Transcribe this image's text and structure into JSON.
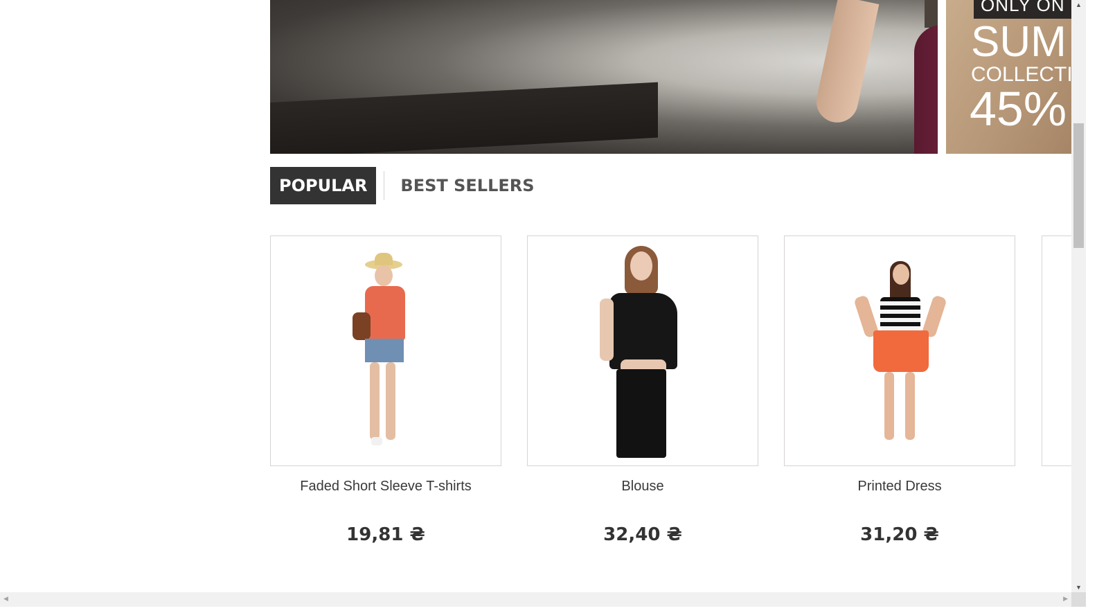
{
  "slider": {
    "prev_icon": "‹",
    "next_icon": "›"
  },
  "promo": {
    "tag": "ONLY ON",
    "headline": "SUM",
    "subline": "COLLECTIO",
    "discount": "45%"
  },
  "tabs": {
    "popular": "POPULAR",
    "best_sellers": "BEST SELLERS"
  },
  "products": [
    {
      "name": "Faded Short Sleeve T-shirts",
      "price": "19,81 ₴"
    },
    {
      "name": "Blouse",
      "price": "32,40 ₴"
    },
    {
      "name": "Printed Dress",
      "price": "31,20 ₴"
    }
  ],
  "scrollbars": {
    "up": "▲",
    "down": "▼",
    "left": "◀",
    "right": "▶"
  }
}
